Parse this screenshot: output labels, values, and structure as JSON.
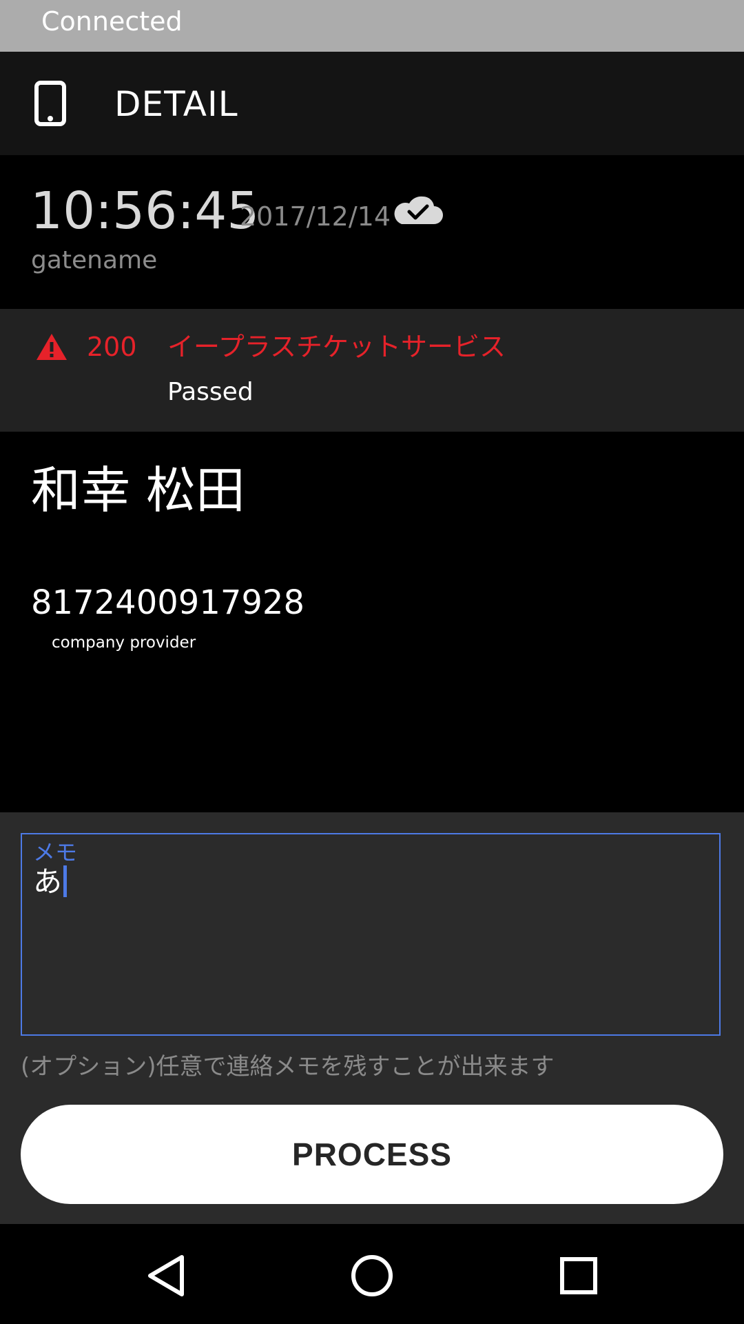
{
  "status_bar": {
    "text": "Connected"
  },
  "app_bar": {
    "icon": "phone-icon",
    "title": "DETAIL"
  },
  "entry": {
    "time": "10:56:45",
    "date": "2017/12/14",
    "sync_icon": "cloud-check-icon",
    "gate": "gatename"
  },
  "result": {
    "icon": "warning-icon",
    "code": "200",
    "service": "イープラスチケットサービス",
    "status": "Passed",
    "accent_color": "#e6222a"
  },
  "person": {
    "name": "和幸 松田",
    "number": "8172400917928",
    "provider": "company provider"
  },
  "memo": {
    "label": "メモ",
    "value": "あ",
    "hint": "(オプション)任意で連絡メモを残すことが出来ます",
    "focus_color": "#4d7ae6"
  },
  "process_button": {
    "label": "PROCESS"
  },
  "nav_bar": {
    "back_icon": "back-triangle-icon",
    "home_icon": "home-circle-icon",
    "recents_icon": "recents-square-icon"
  }
}
